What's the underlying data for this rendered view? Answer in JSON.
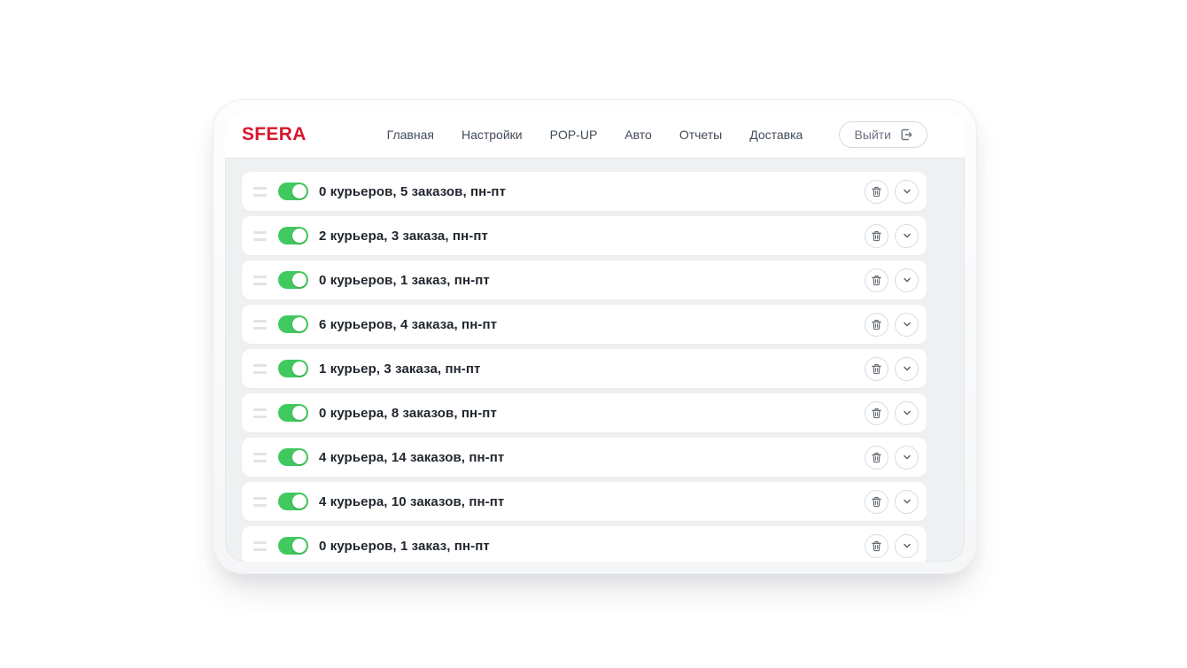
{
  "header": {
    "logo": "SFERA",
    "nav_items": [
      "Главная",
      "Настройки",
      "POP-UP",
      "Авто",
      "Отчеты",
      "Доставка"
    ],
    "logout_label": "Выйти"
  },
  "list": {
    "rows": [
      {
        "label": "0 курьеров, 5 заказов, пн-пт",
        "enabled": true
      },
      {
        "label": "2 курьера, 3 заказа, пн-пт",
        "enabled": true
      },
      {
        "label": "0 курьеров, 1 заказ, пн-пт",
        "enabled": true
      },
      {
        "label": "6 курьеров, 4 заказа, пн-пт",
        "enabled": true
      },
      {
        "label": "1 курьер, 3 заказа, пн-пт",
        "enabled": true
      },
      {
        "label": "0 курьера, 8 заказов, пн-пт",
        "enabled": true
      },
      {
        "label": "4 курьера, 14 заказов, пн-пт",
        "enabled": true
      },
      {
        "label": "4 курьера, 10 заказов, пн-пт",
        "enabled": true
      },
      {
        "label": "0 курьеров, 1 заказ, пн-пт",
        "enabled": true
      }
    ]
  },
  "icons": {
    "logout": "logout-icon",
    "drag": "drag-handle-icon",
    "delete": "trash-icon",
    "expand": "chevron-down-icon"
  },
  "colors": {
    "brand_red": "#d7182f",
    "toggle_green": "#41c95f",
    "screen_bg": "#eef0f2",
    "nav_text": "#414b57",
    "row_text": "#20262e",
    "muted_gray": "#6b7280"
  }
}
